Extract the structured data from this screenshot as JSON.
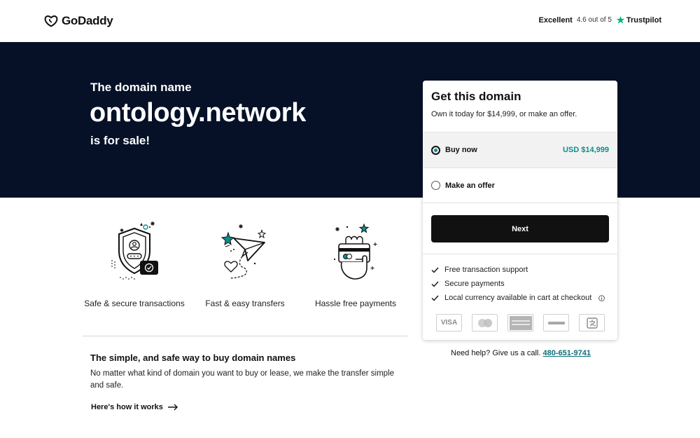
{
  "header": {
    "logo_text": "GoDaddy",
    "trustpilot": {
      "rating_word": "Excellent",
      "score_text": "4.6 out of 5",
      "brand": "Trustpilot"
    }
  },
  "hero": {
    "kicker": "The domain name",
    "domain": "ontology.network",
    "for_sale": "is for sale!"
  },
  "features": [
    {
      "label": "Safe & secure transactions",
      "icon": "shield-icon"
    },
    {
      "label": "Fast & easy transfers",
      "icon": "paper-plane-icon"
    },
    {
      "label": "Hassle free payments",
      "icon": "payment-hand-icon"
    }
  ],
  "info": {
    "title": "The simple, and safe way to buy domain names",
    "body": "No matter what kind of domain you want to buy or lease, we make the transfer simple and safe.",
    "link": "Here's how it works"
  },
  "card": {
    "title": "Get this domain",
    "subtitle": "Own it today for $14,999, or make an offer.",
    "options": [
      {
        "label": "Buy now",
        "price": "USD $14,999",
        "selected": true
      },
      {
        "label": "Make an offer",
        "selected": false
      }
    ],
    "next_label": "Next",
    "benefits": [
      "Free transaction support",
      "Secure payments",
      "Local currency available in cart at checkout"
    ],
    "payment_methods": [
      "VISA",
      "Mastercard",
      "American Express",
      "PayPal",
      "Alipay"
    ]
  },
  "help": {
    "text": "Need help? Give us a call.",
    "phone": "480-651-9741"
  },
  "colors": {
    "hero_bg": "#061128",
    "accent_teal": "#0d8d8d",
    "button_bg": "#111111"
  }
}
